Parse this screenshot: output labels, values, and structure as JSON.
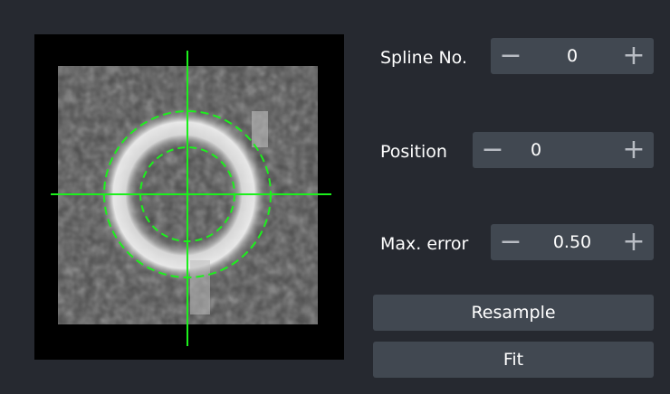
{
  "controls": {
    "spline_no": {
      "label": "Spline No.",
      "value": "0"
    },
    "position": {
      "label": "Position",
      "value": "0"
    },
    "max_error": {
      "label": "Max. error",
      "value": "0.50"
    }
  },
  "buttons": {
    "resample_label": "Resample",
    "fit_label": "Fit"
  },
  "icons": {
    "minus": "−",
    "plus": "+"
  },
  "colors": {
    "background": "#262930",
    "control": "#414851",
    "overlay": "#00ff00"
  }
}
